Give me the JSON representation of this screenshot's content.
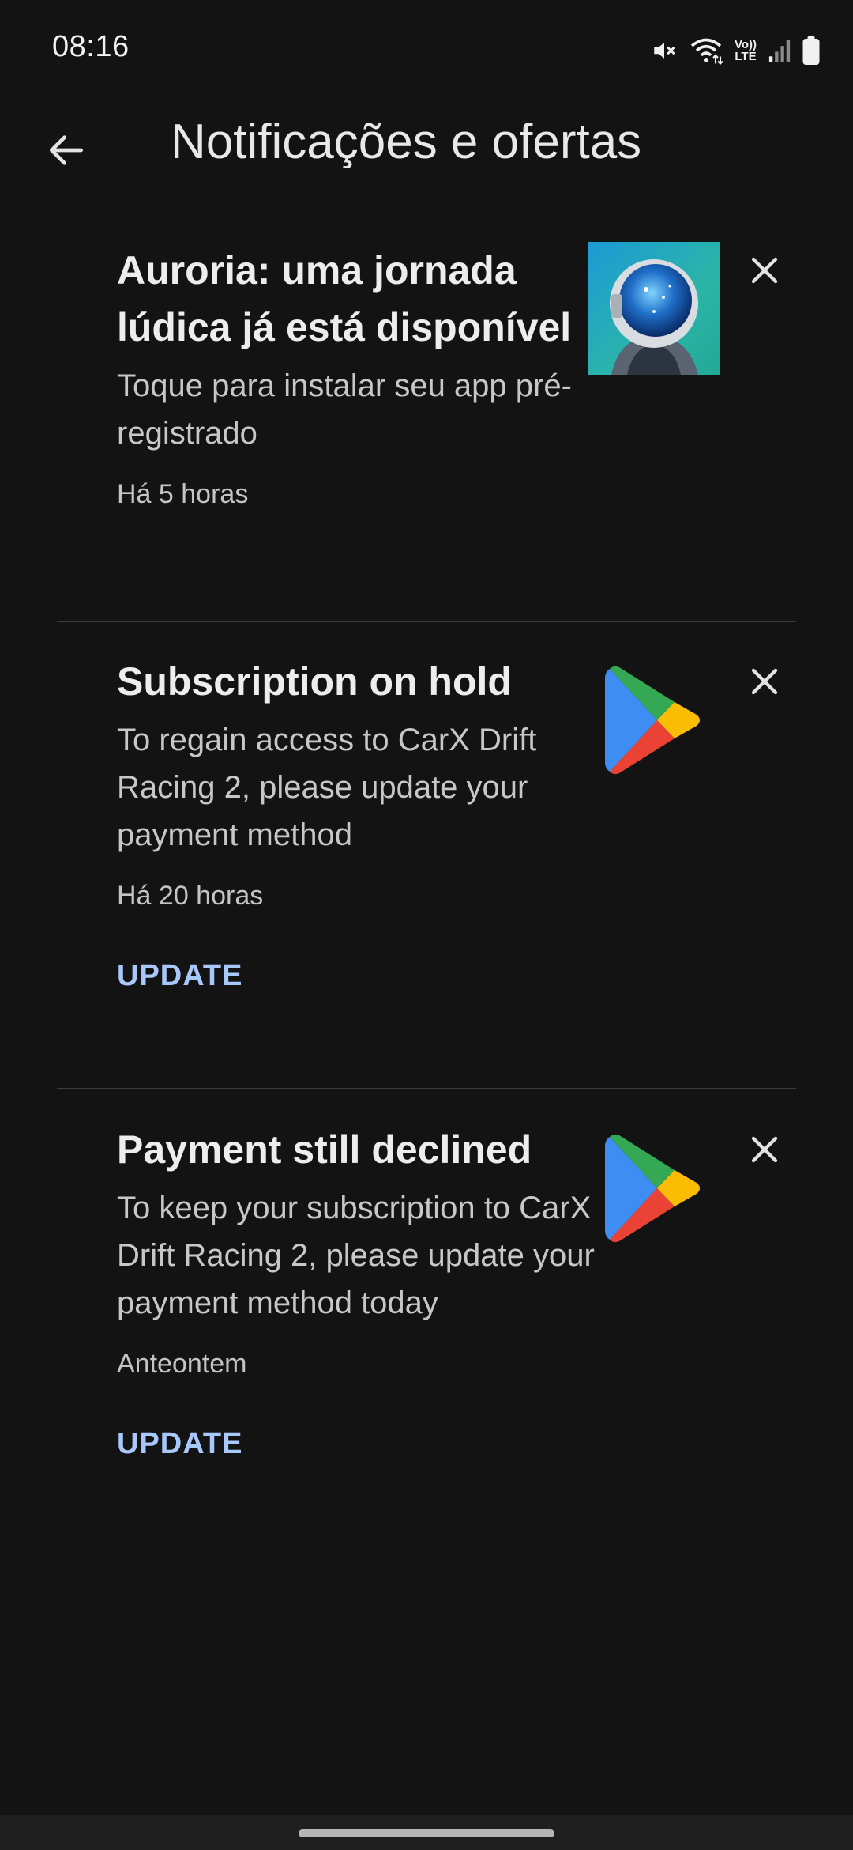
{
  "status_bar": {
    "time": "08:16",
    "icons": [
      "mute-icon",
      "wifi-icon",
      "volte-icon",
      "signal-icon",
      "battery-icon"
    ],
    "volte_top": "Vo))",
    "volte_bottom": "LTE"
  },
  "app_bar": {
    "back_icon": "arrow-back-icon",
    "title": "Notificações e ofertas"
  },
  "notifications": [
    {
      "title": "Auroria: uma jornada lúdica já está disponível",
      "text": "Toque para instalar seu app pré-registrado",
      "time": "Há 5 horas",
      "image": "auroria-app-icon",
      "action": ""
    },
    {
      "title": "Subscription on hold",
      "text": "To regain access to CarX Drift Racing 2, please update your payment method",
      "time": "Há 20 horas",
      "image": "google-play-icon",
      "action": "UPDATE"
    },
    {
      "title": "Payment still declined",
      "text": "To keep your subscription to CarX Drift Racing 2, please update your payment method today",
      "time": "Anteontem",
      "image": "google-play-icon",
      "action": "UPDATE"
    }
  ],
  "colors": {
    "background": "#131314",
    "action": "#a8c7fa",
    "divider": "#3c3c3c"
  }
}
